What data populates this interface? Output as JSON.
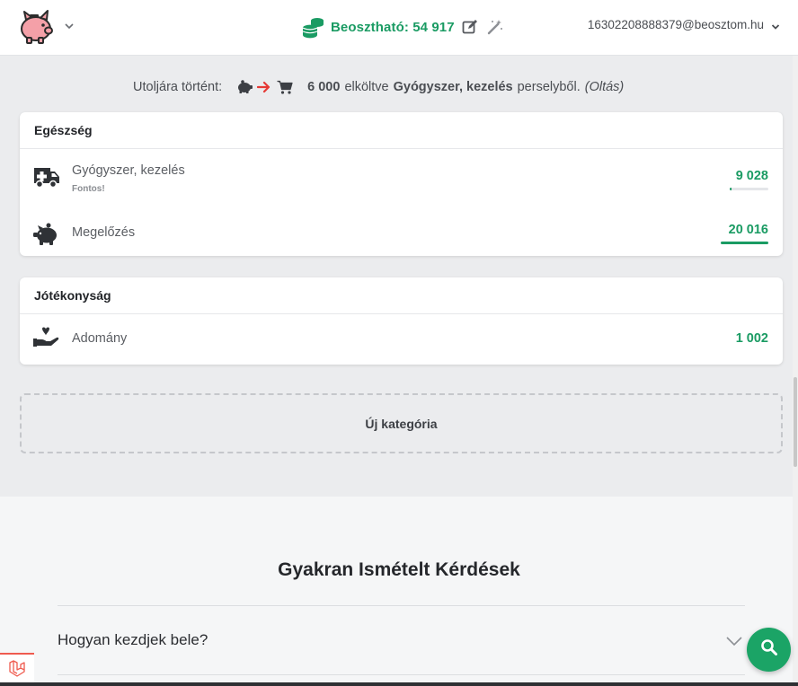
{
  "header": {
    "balance_label": "Beosztható: 54 917",
    "user_email": "16302208888379@beosztom.hu"
  },
  "last_activity": {
    "prefix": "Utoljára történt:",
    "amount": "6 000",
    "verb": "elköltve",
    "category": "Gyógyszer, kezelés",
    "suffix": "perselyből.",
    "note": "(Oltás)"
  },
  "groups": [
    {
      "title": "Egészség",
      "items": [
        {
          "name": "Gyógyszer, kezelés",
          "subtitle": "Fontos!",
          "value": "9 028",
          "icon": "ambulance-icon",
          "progress": 0.05
        },
        {
          "name": "Megelőzés",
          "value": "20 016",
          "icon": "piggy-bank-icon",
          "progress": 1.0
        }
      ]
    },
    {
      "title": "Jótékonyság",
      "items": [
        {
          "name": "Adomány",
          "value": "1 002",
          "icon": "hand-holding-heart-icon"
        }
      ]
    }
  ],
  "new_category_label": "Új kategória",
  "faq": {
    "title": "Gyakran Ismételt Kérdések",
    "questions": [
      "Hogyan kezdjek bele?"
    ]
  },
  "colors": {
    "accent": "#1a9b63",
    "background": "#ebecee",
    "arrow": "#e53935",
    "logo_pig": "#f4a0a8"
  }
}
